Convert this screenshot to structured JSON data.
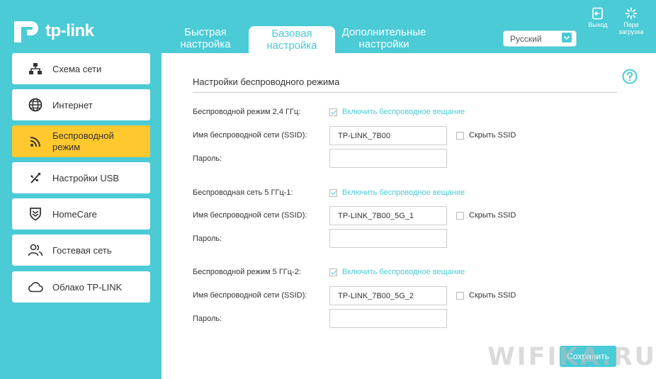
{
  "brand": {
    "name": "tp-link",
    "accent": "#4acbd6",
    "active_bg": "#ffc82f"
  },
  "tabs": [
    {
      "label_line1": "Быстрая",
      "label_line2": "настройка"
    },
    {
      "label_line1": "Базовая",
      "label_line2": "настройка"
    },
    {
      "label_line1": "Дополнительные",
      "label_line2": "настройки"
    }
  ],
  "language": {
    "selected": "Русский"
  },
  "header_buttons": {
    "exit": "Выход",
    "reboot_line1": "Пере",
    "reboot_line2": "загрузка"
  },
  "sidebar": {
    "items": [
      {
        "label": "Схема сети",
        "icon": "network-map-icon"
      },
      {
        "label": "Интернет",
        "icon": "globe-icon"
      },
      {
        "label_line1": "Беспроводной",
        "label_line2": "режим",
        "icon": "wifi-icon"
      },
      {
        "label": "Настройки USB",
        "icon": "usb-icon"
      },
      {
        "label": "HomeCare",
        "icon": "shield-icon"
      },
      {
        "label": "Гостевая сеть",
        "icon": "guests-icon"
      },
      {
        "label": "Облако TP-LINK",
        "icon": "cloud-icon"
      }
    ]
  },
  "section": {
    "title": "Настройки беспроводного режима"
  },
  "bands": [
    {
      "label": "Беспроводной режим 2,4 ГГц:",
      "enable_label": "Включить беспроводное вещание",
      "ssid_label": "Имя беспроводной сети (SSID):",
      "ssid_value": "TP-LINK_7B00",
      "hide_label": "Скрыть SSID",
      "password_label": "Пароль:",
      "password_value": ""
    },
    {
      "label": "Беспроводная сеть 5 ГГц-1:",
      "enable_label": "Включить беспроводное вещание",
      "ssid_label": "Имя беспроводной сети (SSID):",
      "ssid_value": "TP-LINK_7B00_5G_1",
      "hide_label": "Скрыть SSID",
      "password_label": "Пароль:",
      "password_value": ""
    },
    {
      "label": "Беспроводной режим 5 ГГц-2:",
      "enable_label": "Включить беспроводное вещание",
      "ssid_label": "Имя беспроводной сети (SSID):",
      "ssid_value": "TP-LINK_7B00_5G_2",
      "hide_label": "Скрыть SSID",
      "password_label": "Пароль:",
      "password_value": ""
    }
  ],
  "actions": {
    "save": "Сохранить"
  },
  "watermark": "WIFIKA.RU"
}
